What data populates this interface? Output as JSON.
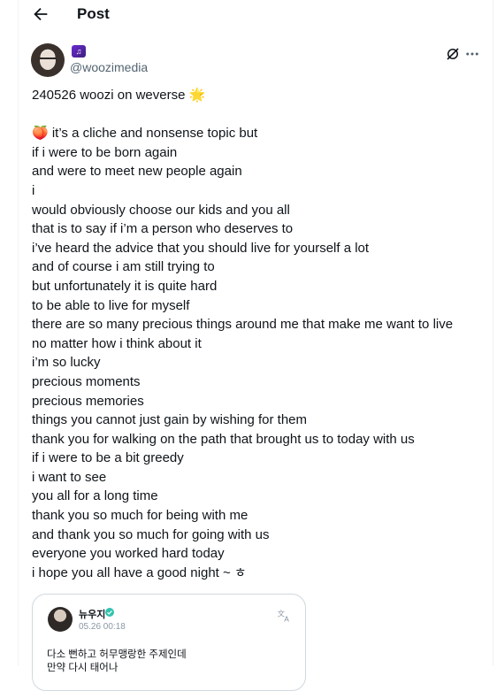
{
  "header": {
    "title": "Post"
  },
  "author": {
    "handle": "@woozimedia",
    "name_emoji": "♫"
  },
  "post": {
    "lines": [
      "240526 woozi on weverse 🌟",
      "",
      "🍑 it’s a cliche and nonsense topic but",
      "if i were to be born again",
      "and were to meet new people again",
      "i",
      "would obviously choose our kids and you all",
      "that is to say if i’m a person who deserves to",
      "i’ve heard the advice that you should live for yourself a lot",
      "and of course i am still trying to",
      "but unfortunately it is quite hard",
      "to be able to live for myself",
      "there are so many precious things around me that make me want to live",
      "no matter how i think about it",
      "i’m so lucky",
      "precious moments",
      "precious memories",
      "things you cannot just gain by wishing for them",
      "thank you for walking on the path that brought us to today with us",
      "if i were to be a bit greedy",
      "i want to see",
      "you all for a long time",
      "thank you so much for being with me",
      "and thank you so much for going with us",
      "everyone you worked hard today",
      "i hope you all have a good night ~ ㅎ"
    ]
  },
  "quote": {
    "name": "뉴우지",
    "date": "05.26 00:18",
    "text_lines": [
      "다소 뻔하고 허무맹랑한 주제인데",
      "만약 다시 태어나"
    ]
  }
}
